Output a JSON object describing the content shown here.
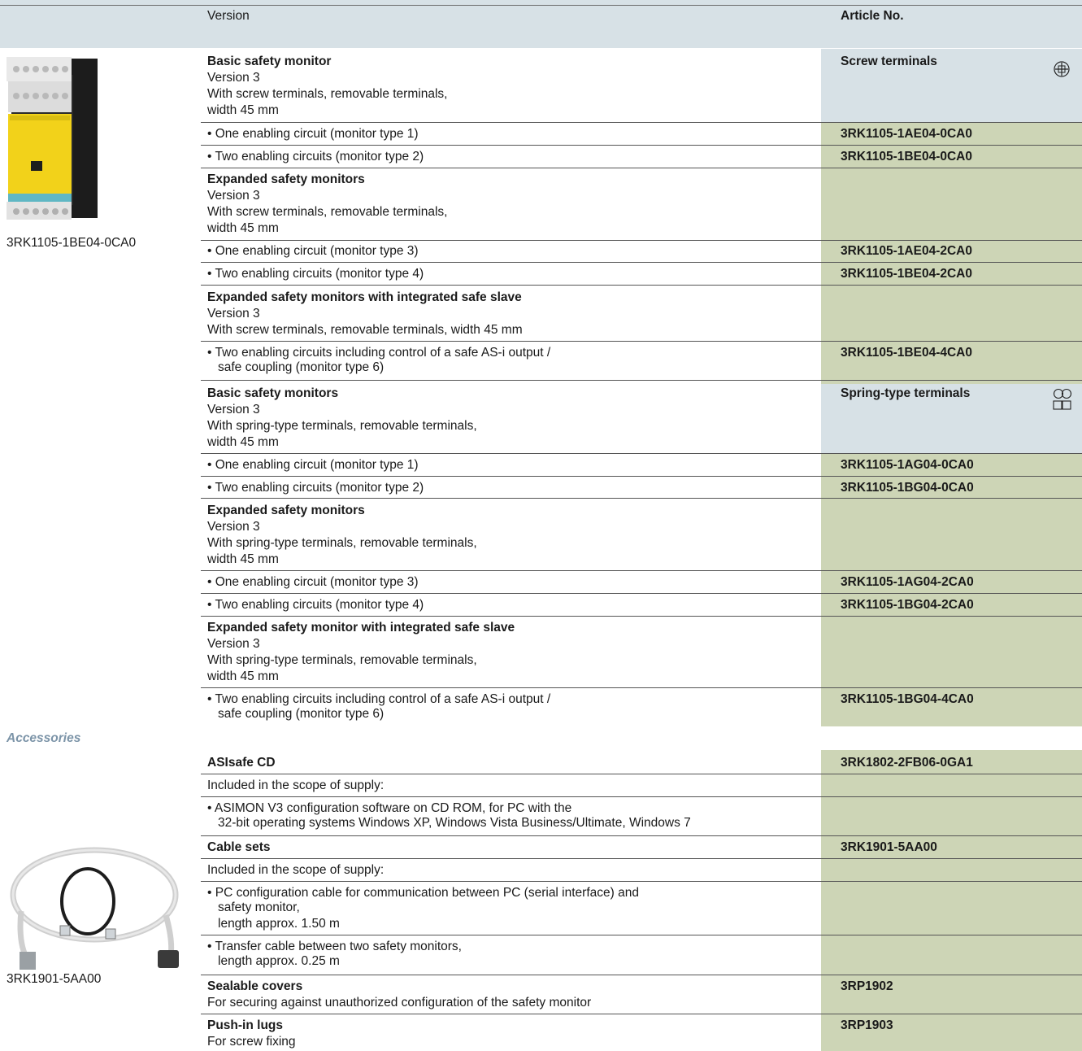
{
  "header": {
    "version_label": "Version",
    "article_label": "Article No."
  },
  "images": {
    "monitor_caption": "3RK1105-1BE04-0CA0",
    "cable_caption": "3RK1901-5AA00"
  },
  "groups": {
    "screw_label": "Screw terminals",
    "spring_label": "Spring-type terminals",
    "g1": {
      "title": "Basic safety monitor",
      "l1": "Version 3",
      "l2": "With screw terminals, removable terminals,",
      "l3": "width 45 mm",
      "r1": "• One enabling circuit (monitor type 1)",
      "a1": "3RK1105-1AE04-0CA0",
      "r2": "• Two enabling circuits (monitor type 2)",
      "a2": "3RK1105-1BE04-0CA0"
    },
    "g2": {
      "title": "Expanded safety monitors",
      "l1": "Version 3",
      "l2": "With screw terminals, removable terminals,",
      "l3": "width 45 mm",
      "r1": "• One enabling circuit (monitor type 3)",
      "a1": "3RK1105-1AE04-2CA0",
      "r2": "• Two enabling circuits (monitor type 4)",
      "a2": "3RK1105-1BE04-2CA0"
    },
    "g3": {
      "title": "Expanded safety monitors with integrated safe slave",
      "l1": "Version 3",
      "l2": "With screw terminals, removable terminals, width 45 mm",
      "r1": "• Two enabling circuits including control of a safe AS-i output /",
      "r1b": "safe coupling (monitor type 6)",
      "a1": "3RK1105-1BE04-4CA0"
    },
    "g4": {
      "title": "Basic safety monitors",
      "l1": "Version 3",
      "l2": "With spring-type terminals, removable terminals,",
      "l3": "width 45 mm",
      "r1": "• One enabling circuit (monitor type 1)",
      "a1": "3RK1105-1AG04-0CA0",
      "r2": "• Two enabling circuits (monitor type 2)",
      "a2": "3RK1105-1BG04-0CA0"
    },
    "g5": {
      "title": "Expanded safety monitors",
      "l1": "Version 3",
      "l2": "With spring-type terminals, removable terminals,",
      "l3": "width 45 mm",
      "r1": "• One enabling circuit (monitor type 3)",
      "a1": "3RK1105-1AG04-2CA0",
      "r2": "• Two enabling circuits (monitor type 4)",
      "a2": "3RK1105-1BG04-2CA0"
    },
    "g6": {
      "title": "Expanded safety monitor with integrated safe slave",
      "l1": "Version 3",
      "l2": "With spring-type terminals, removable terminals,",
      "l3": "width 45 mm",
      "r1": "• Two enabling circuits including control of a safe AS-i output /",
      "r1b": "safe coupling (monitor type 6)",
      "a1": "3RK1105-1BG04-4CA0"
    }
  },
  "accessories": {
    "heading": "Accessories",
    "cd": {
      "title": "ASIsafe CD",
      "article": "3RK1802-2FB06-0GA1",
      "scope": "Included in the scope of supply:",
      "b1": "• ASIMON V3 configuration software on CD ROM, for PC with the",
      "b1b": "32-bit operating systems Windows XP, Windows Vista Business/Ultimate, Windows 7"
    },
    "cable": {
      "title": "Cable sets",
      "article": "3RK1901-5AA00",
      "scope": "Included in the scope of supply:",
      "b1": "• PC configuration cable for communication between PC (serial interface) and",
      "b1b": "safety monitor,",
      "b1c": "length approx. 1.50 m",
      "b2": "• Transfer cable between two safety monitors,",
      "b2b": "length approx. 0.25 m"
    },
    "covers": {
      "title": "Sealable covers",
      "article": "3RP1902",
      "desc": "For securing against unauthorized configuration of the safety monitor"
    },
    "lugs": {
      "title": "Push-in lugs",
      "article": "3RP1903",
      "desc": "For screw fixing"
    }
  }
}
